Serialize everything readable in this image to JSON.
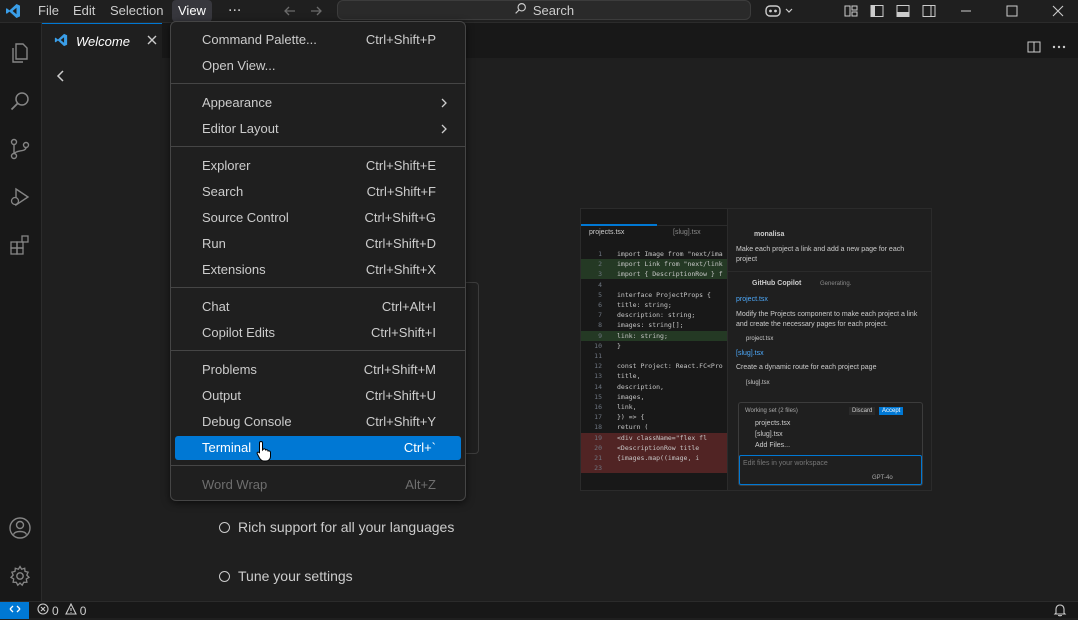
{
  "menubar": {
    "items": [
      "File",
      "Edit",
      "Selection",
      "View"
    ],
    "more": "...",
    "search_label": "Search"
  },
  "tab": {
    "title": "Welcome"
  },
  "dropdown": {
    "groups": [
      [
        {
          "label": "Command Palette...",
          "shortcut": "Ctrl+Shift+P"
        },
        {
          "label": "Open View...",
          "shortcut": ""
        }
      ],
      [
        {
          "label": "Appearance",
          "submenu": true
        },
        {
          "label": "Editor Layout",
          "submenu": true
        }
      ],
      [
        {
          "label": "Explorer",
          "shortcut": "Ctrl+Shift+E"
        },
        {
          "label": "Search",
          "shortcut": "Ctrl+Shift+F"
        },
        {
          "label": "Source Control",
          "shortcut": "Ctrl+Shift+G"
        },
        {
          "label": "Run",
          "shortcut": "Ctrl+Shift+D"
        },
        {
          "label": "Extensions",
          "shortcut": "Ctrl+Shift+X"
        }
      ],
      [
        {
          "label": "Chat",
          "shortcut": "Ctrl+Alt+I"
        },
        {
          "label": "Copilot Edits",
          "shortcut": "Ctrl+Shift+I"
        }
      ],
      [
        {
          "label": "Problems",
          "shortcut": "Ctrl+Shift+M"
        },
        {
          "label": "Output",
          "shortcut": "Ctrl+Shift+U"
        },
        {
          "label": "Debug Console",
          "shortcut": "Ctrl+Shift+Y"
        },
        {
          "label": "Terminal",
          "shortcut": "Ctrl+`",
          "highlighted": true
        }
      ],
      [
        {
          "label": "Word Wrap",
          "shortcut": "Alt+Z",
          "disabled": true
        }
      ]
    ]
  },
  "walkthrough": {
    "items": [
      "Rich support for all your languages",
      "Tune your settings"
    ]
  },
  "preview": {
    "tabs": [
      "projects.tsx",
      "[slug].tsx"
    ],
    "code": [
      {
        "n": "1",
        "t": "import Image from \"next/ima"
      },
      {
        "n": "2",
        "t": "import Link from \"next/link"
      },
      {
        "n": "3",
        "t": "import { DescriptionRow } f"
      },
      {
        "n": "4",
        "t": ""
      },
      {
        "n": "5",
        "t": "interface ProjectProps {"
      },
      {
        "n": "6",
        "t": "  title: string;"
      },
      {
        "n": "7",
        "t": "  description: string;"
      },
      {
        "n": "8",
        "t": "  images: string[];"
      },
      {
        "n": "9",
        "t": "  link: string;"
      },
      {
        "n": "10",
        "t": "}"
      },
      {
        "n": "11",
        "t": ""
      },
      {
        "n": "12",
        "t": "const Project: React.FC<Pro"
      },
      {
        "n": "13",
        "t": "  title,"
      },
      {
        "n": "14",
        "t": "  description,"
      },
      {
        "n": "15",
        "t": "  images,"
      },
      {
        "n": "16",
        "t": "  link,"
      },
      {
        "n": "17",
        "t": "}) => {"
      },
      {
        "n": "18",
        "t": "  return ("
      },
      {
        "n": "19",
        "t": "    <div className=\"flex fl"
      },
      {
        "n": "20",
        "t": "      <DescriptionRow title"
      },
      {
        "n": "21",
        "t": "      {images.map((image, i"
      },
      {
        "n": "23",
        "t": ""
      }
    ],
    "chat": {
      "user": "monalisa",
      "prompt": "Make each project a link and add a new page for each project",
      "assistant": "GitHub Copilot",
      "status": "Generating.",
      "file1": "project.tsx",
      "desc1": "Modify the Projects component to make each project a link and create the necessary pages for each project.",
      "chip1": "project.tsx",
      "file2": "[slug].tsx",
      "desc2": "Create a dynamic route for each project page",
      "chip2": "[slug].tsx",
      "working_set": "Working set (2 files)",
      "discard": "Discard",
      "accept": "Accept",
      "ws_files": [
        "projects.tsx",
        "[slug].tsx"
      ],
      "add_files": "Add Files...",
      "input_placeholder": "Edit files in your workspace",
      "model": "GPT-4o"
    }
  },
  "status": {
    "errors": "0",
    "warnings": "0"
  }
}
